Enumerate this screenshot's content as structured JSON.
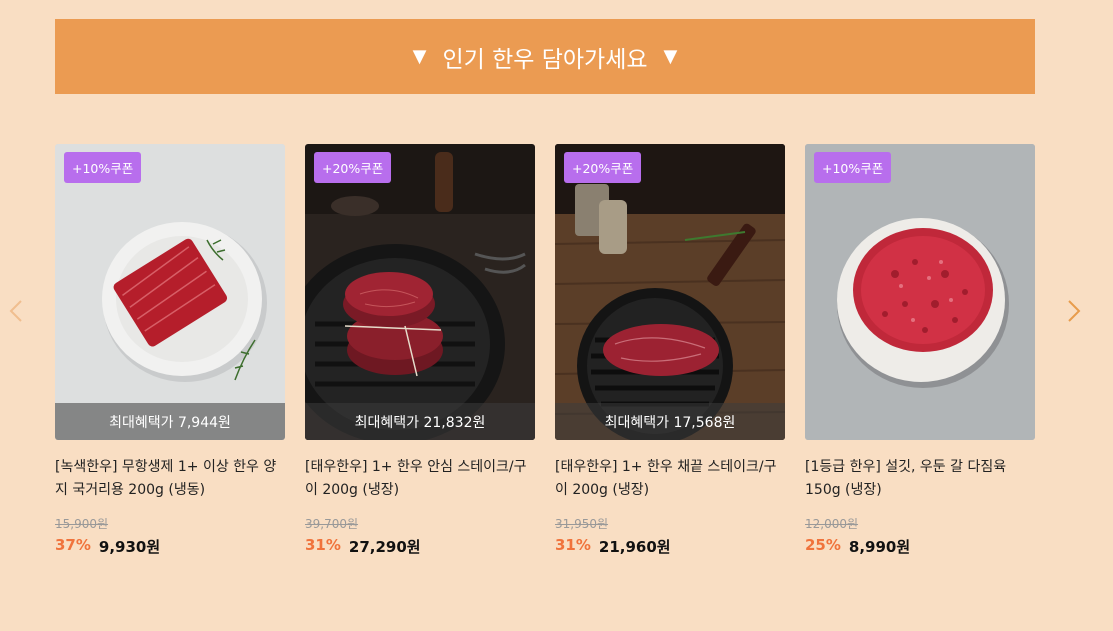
{
  "banner": {
    "title": "인기 한우 담아가세요",
    "left_mark": "▼",
    "right_mark": "▼"
  },
  "navigation": {
    "prev_icon": "chevron-left-icon",
    "next_icon": "chevron-right-icon"
  },
  "colors": {
    "background": "#f9dec3",
    "banner": "#eb9b52",
    "coupon": "#b86eed",
    "discount": "#f0733c"
  },
  "products": [
    {
      "coupon": "+10%쿠폰",
      "max_benefit": "최대혜택가 7,944원",
      "name": "[녹색한우] 무항생제 1+ 이상 한우 양지 국거리용 200g (냉동)",
      "original_price": "15,900원",
      "discount_rate": "37%",
      "sale_price": "9,930원"
    },
    {
      "coupon": "+20%쿠폰",
      "max_benefit": "최대혜택가 21,832원",
      "name": "[태우한우] 1+ 한우 안심 스테이크/구이 200g (냉장)",
      "original_price": "39,700원",
      "discount_rate": "31%",
      "sale_price": "27,290원"
    },
    {
      "coupon": "+20%쿠폰",
      "max_benefit": "최대혜택가 17,568원",
      "name": "[태우한우] 1+ 한우 채끝 스테이크/구이 200g (냉장)",
      "original_price": "31,950원",
      "discount_rate": "31%",
      "sale_price": "21,960원"
    },
    {
      "coupon": "+10%쿠폰",
      "max_benefit": "",
      "name": "[1등급 한우] 설깃, 우둔 갈 다짐육 150g (냉장)",
      "original_price": "12,000원",
      "discount_rate": "25%",
      "sale_price": "8,990원"
    }
  ]
}
